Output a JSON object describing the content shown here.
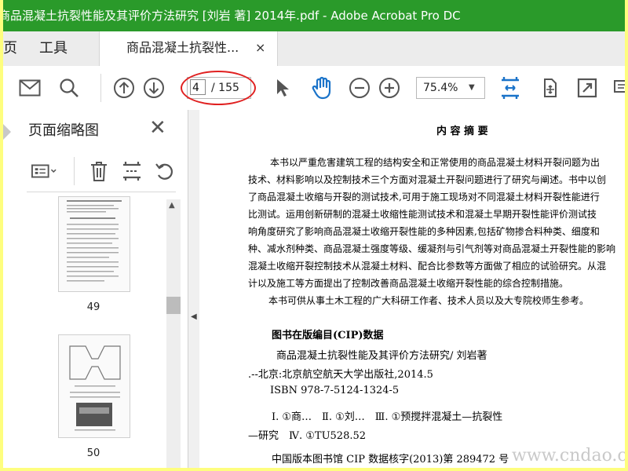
{
  "window": {
    "title": "商品混凝土抗裂性能及其评价方法研究 [刘岩 著] 2014年.pdf - Adobe Acrobat Pro DC"
  },
  "menu": {
    "home_partial": "页",
    "tools": "工具"
  },
  "doc_tab": {
    "label": "商品混凝土抗裂性...",
    "close": "×"
  },
  "toolbar": {
    "page_current": "4",
    "page_total": "/ 155",
    "zoom": "75.4%",
    "icons": [
      "mail-icon",
      "search-icon",
      "arrow-up-icon",
      "arrow-down-icon",
      "cursor-icon",
      "hand-icon",
      "zoom-out-icon",
      "zoom-in-icon",
      "fit-page-icon",
      "rotate-pages-icon",
      "full-screen-icon",
      "comment-icon"
    ]
  },
  "panel": {
    "title": "页面缩略图",
    "thumbnails": [
      {
        "label": "49"
      },
      {
        "label": "50"
      }
    ]
  },
  "doc": {
    "heading": "内 容 摘 要",
    "abstract": [
      "本书以严重危害建筑工程的结构安全和正常使用的商品混凝土材料开裂问题为出",
      "技术、材料影响以及控制技术三个方面对混凝土开裂问题进行了研究与阐述。书中以创",
      "了商品混凝土收缩与开裂的测试技术,可用于施工现场对不同混凝土材料开裂性能进行",
      "比测试。运用创新研制的混凝土收缩性能测试技术和混凝土早期开裂性能评价测试技",
      "响角度研究了影响商品混凝土收缩开裂性能的多种因素,包括矿物掺合料种类、细度和",
      "种、减水剂种类、商品混凝土强度等级、缓凝剂与引气剂等对商品混凝土开裂性能的影响",
      "混凝土收缩开裂控制技术从混凝土材料、配合比参数等方面做了相应的试验研究。从混",
      "计以及施工等方面提出了控制改善商品混凝土收缩开裂性能的综合控制措施。",
      "本书可供从事土木工程的广大科研工作者、技术人员以及大专院校师生参考。"
    ],
    "cip_heading": "图书在版编目(CIP)数据",
    "cip_lines": [
      "商品混凝土抗裂性能及其评价方法研究/ 刘岩著",
      ".--北京:北京航空航天大学出版社,2014.5",
      "ISBN 978-7-5124-1324-5",
      "Ⅰ. ①商…　Ⅱ. ①刘…　Ⅲ. ①预搅拌混凝土—抗裂性",
      "—研究　Ⅳ. ①TU528.52",
      "中国版本图书馆 CIP 数据核字(2013)第 289472 号"
    ],
    "watermark": "www.cndao.com"
  }
}
